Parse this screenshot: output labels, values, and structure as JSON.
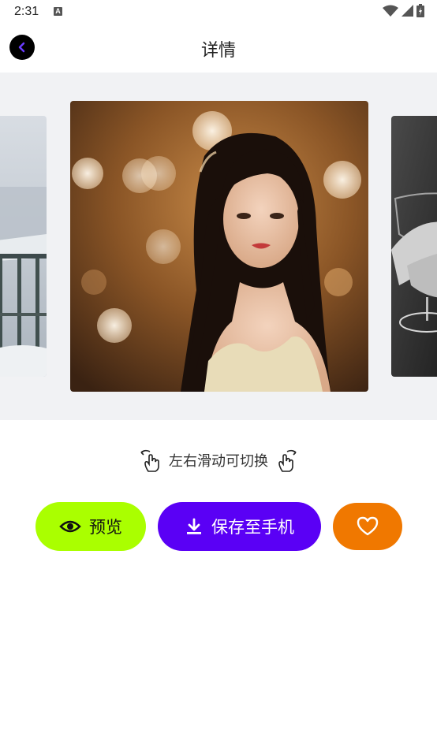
{
  "status_bar": {
    "time": "2:31",
    "notification_icon": "a-icon",
    "icons": [
      "wifi-icon",
      "cell-signal-icon",
      "battery-icon"
    ]
  },
  "header": {
    "title": "详情",
    "back_icon": "chevron-left-icon"
  },
  "carousel": {
    "slides": [
      "snowy-balcony-image",
      "portrait-bokeh-image",
      "wine-glass-hand-image"
    ],
    "active_index": 1
  },
  "hint": {
    "text": "左右滑动可切换"
  },
  "actions": {
    "preview_label": "预览",
    "save_label": "保存至手机",
    "favorite_icon": "heart-icon"
  },
  "colors": {
    "preview_bg": "#aaff00",
    "save_bg": "#5a00f5",
    "favorite_bg": "#f07800",
    "back_arrow": "#6a3cff"
  }
}
